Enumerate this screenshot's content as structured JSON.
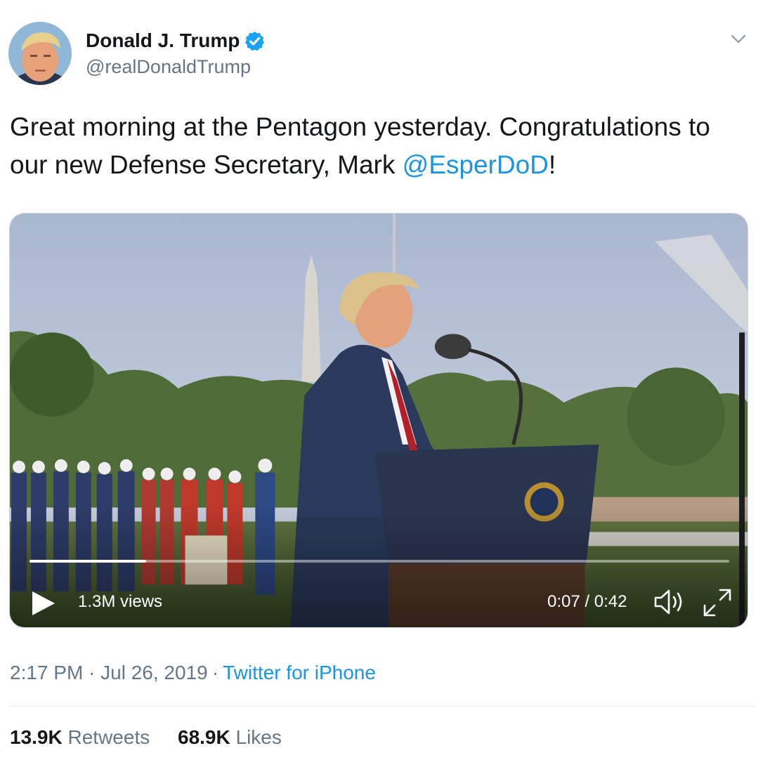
{
  "tweet": {
    "author": {
      "display_name": "Donald J. Trump",
      "handle": "@realDonaldTrump",
      "verified": true
    },
    "text_before_mention": "Great morning at the Pentagon yesterday. Congratulations to our new Defense Secretary, Mark ",
    "mention": "@EsperDoD",
    "text_after_mention": "!",
    "timestamp": "2:17 PM · Jul 26, 2019",
    "separator": "·",
    "source": "Twitter for iPhone"
  },
  "video": {
    "views": "1.3M views",
    "time": "0:07 / 0:42",
    "progress": 0.167
  },
  "stats": {
    "retweets_count": "13.9K",
    "retweets_label": "Retweets",
    "likes_count": "68.9K",
    "likes_label": "Likes"
  },
  "icons": {
    "caret": "chevron-down-icon",
    "verified": "verified-badge-icon",
    "play": "play-icon",
    "volume": "volume-icon",
    "fullscreen": "fullscreen-icon"
  },
  "colors": {
    "link": "#1b95e0",
    "secondary_text": "#657786",
    "primary_text": "#14171a"
  }
}
